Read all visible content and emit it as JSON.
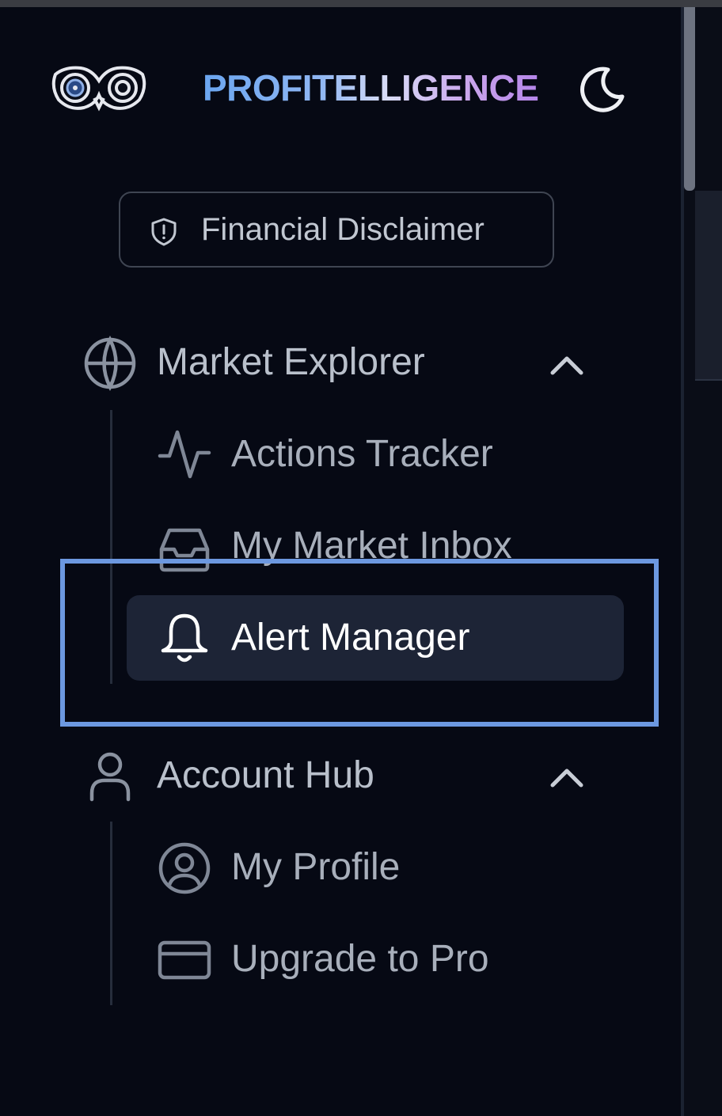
{
  "brand": {
    "name": "PROFITELLIGENCE",
    "logo_icon": "owl-eyes-logo",
    "theme_icon": "moon-icon"
  },
  "disclaimer": {
    "label": "Financial Disclaimer",
    "icon": "shield-alert-icon"
  },
  "nav": {
    "market_explorer": {
      "label": "Market Explorer",
      "icon": "globe-icon",
      "expanded": true,
      "items": [
        {
          "label": "Actions Tracker",
          "icon": "activity-pulse-icon",
          "active": false
        },
        {
          "label": "My Market Inbox",
          "icon": "inbox-icon",
          "active": false
        },
        {
          "label": "Alert Manager",
          "icon": "bell-icon",
          "active": true
        }
      ]
    },
    "account_hub": {
      "label": "Account Hub",
      "icon": "user-icon",
      "expanded": true,
      "items": [
        {
          "label": "My Profile",
          "icon": "user-circle-icon",
          "active": false
        },
        {
          "label": "Upgrade to Pro",
          "icon": "credit-card-icon",
          "active": false
        }
      ]
    }
  },
  "colors": {
    "background": "#060914",
    "active_item_bg": "#1d2436",
    "highlight_border": "#6c98e0",
    "text_muted": "#a8afbb",
    "text_active": "#ffffff"
  }
}
